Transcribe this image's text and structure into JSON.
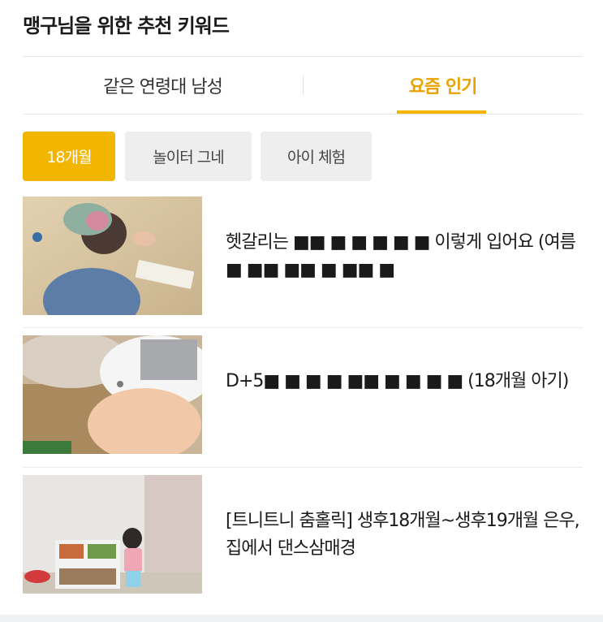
{
  "section": {
    "title": "맹구님을 위한 추천 키워드"
  },
  "tabs": [
    {
      "label": "같은 연령대 남성",
      "active": false
    },
    {
      "label": "요즘 인기",
      "active": true
    }
  ],
  "chips": [
    {
      "label": "18개월",
      "active": true
    },
    {
      "label": "놀이터 그네",
      "active": false
    },
    {
      "label": "아이 체험",
      "active": false
    }
  ],
  "items": [
    {
      "title": "헷갈리는 ■■ ■ ■ ■ ■ ■ 이렇게 입어요 (여름 ■ ■■ ■■ ■ ■■ ■"
    },
    {
      "title": "D+5■ ■ ■ ■ ■■ ■ ■ ■ ■ (18개월 아기)"
    },
    {
      "title": "[트니트니 춤홀릭] 생후18개월~생후19개월 은우, 집에서 댄스삼매경"
    }
  ],
  "colors": {
    "accent": "#f2b600",
    "accent_text": "#e8a200",
    "chip_bg": "#eeeeee",
    "divider": "#ebebeb"
  }
}
